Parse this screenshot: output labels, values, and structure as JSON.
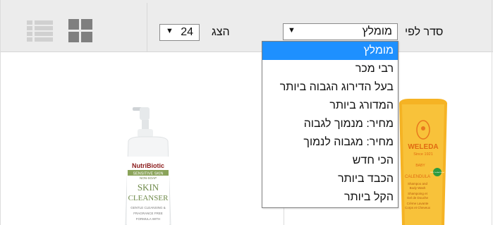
{
  "toolbar": {
    "sort_label": "סדר לפי",
    "sort_selected": "מומלץ",
    "show_label": "הצג",
    "per_page_value": "24",
    "view_list_icon": "list-view-icon",
    "view_grid_icon": "grid-view-icon"
  },
  "sort_dropdown": {
    "options": [
      "מומלץ",
      "רבי מכר",
      "בעל הדירוג הגבוה ביותר",
      "המדורג ביותר",
      "מחיר: מנמוך לגבוה",
      "מחיר: מגבוה לנמוך",
      "הכי חדש",
      "הכבד ביותר",
      "הקל ביותר"
    ],
    "selected_index": 0
  },
  "products": [
    {
      "brand": "NutriBiotic",
      "sub_label": "SENSITIVE SKIN",
      "small_label": "NON-SOAP",
      "name_line1": "SKIN",
      "name_line2": "CLEANSER",
      "desc_line1": "GENTLE CLEANSING &",
      "desc_line2": "FRAGRANCE FREE",
      "desc_line3": "FORMULA WITH"
    },
    {
      "brand": "WELEDA",
      "since": "Since 1921",
      "baby": "BABY",
      "name": "CALENDULA",
      "desc_line1": "Shampoo and",
      "desc_line2": "Body Wash",
      "desc_line3": "Shampoing et",
      "desc_line4": "Gel de Douche",
      "desc_line5": "Crème Lavante",
      "desc_line6": "Corps et Cheveux",
      "badge": "100% Certified Natural"
    }
  ],
  "colors": {
    "toolbar_bg": "#ececec",
    "dropdown_highlight": "#1e90ff",
    "icon_gray": "#cfcfcf",
    "icon_dark": "#7f7f7f",
    "weleda_yellow": "#f5b324",
    "weleda_orange": "#e8781e"
  }
}
